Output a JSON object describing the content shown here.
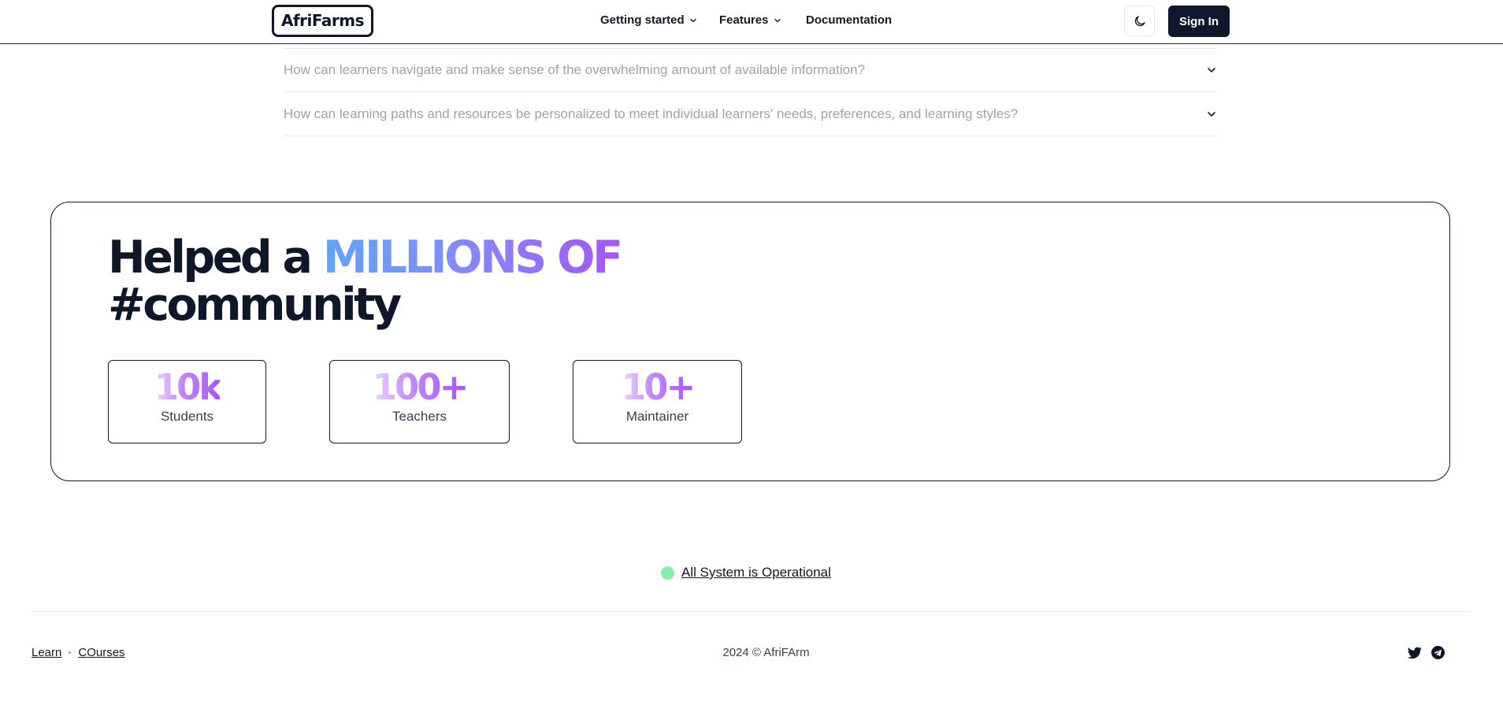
{
  "header": {
    "logo": "AfriFarms",
    "nav": [
      {
        "label": "Getting started",
        "has_dropdown": true
      },
      {
        "label": "Features",
        "has_dropdown": true
      },
      {
        "label": "Documentation",
        "has_dropdown": false
      }
    ],
    "theme_icon": "moon-icon",
    "sign_in_label": "Sign In"
  },
  "faq": {
    "items": [
      {
        "question": "How can learners navigate and make sense of the overwhelming amount of available information?"
      },
      {
        "question": "How can learning paths and resources be personalized to meet individual learners' needs, preferences, and learning styles?"
      }
    ]
  },
  "stats_section": {
    "headline_prefix": "Helped a ",
    "headline_highlight": "MILLIONS OF",
    "headline_second_line": "#community",
    "stats": [
      {
        "value": "10k",
        "label": "Students"
      },
      {
        "value": "100+",
        "label": "Teachers"
      },
      {
        "value": "10+",
        "label": "Maintainer"
      }
    ]
  },
  "status": {
    "text": "All System is Operational",
    "color": "#86efac"
  },
  "footer": {
    "links": [
      "Learn",
      "COurses"
    ],
    "copyright": "2024 © AfriFArm",
    "social_icons": [
      "twitter-icon",
      "telegram-icon"
    ]
  },
  "colors": {
    "primary": "#0f172a",
    "muted_text": "#9ca3af",
    "highlight_gradient": [
      "#60a5fa",
      "#a855f7"
    ]
  }
}
